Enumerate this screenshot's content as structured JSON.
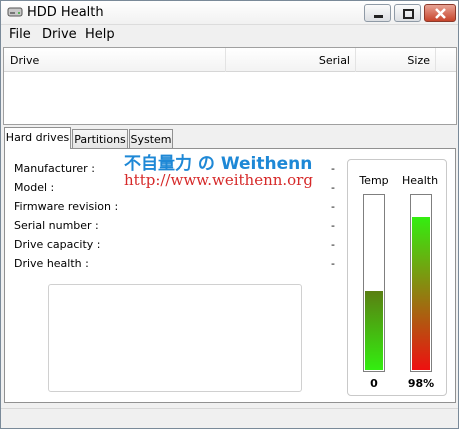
{
  "window": {
    "title": "HDD Health"
  },
  "menu": {
    "file": "File",
    "drive": "Drive",
    "help": "Help"
  },
  "drive_list": {
    "columns": [
      "Drive",
      "Serial",
      "Size"
    ],
    "rows": []
  },
  "tabs": [
    "Hard drives",
    "Partitions",
    "System"
  ],
  "details": {
    "labels": [
      "Manufacturer :",
      "Model :",
      "Firmware revision :",
      "Serial number :",
      "Drive capacity :",
      "Drive health :"
    ],
    "values": [
      "-",
      "-",
      "-",
      "-",
      "-",
      "-"
    ]
  },
  "watermark": {
    "line1": "不自量力 の Weithenn",
    "line2": "http://www.weithenn.org",
    "color1": "#1e88d6",
    "color2": "#d62a2a"
  },
  "gauges": {
    "temp": {
      "label": "Temp",
      "value_text": "0",
      "level": 0.45
    },
    "health": {
      "label": "Health",
      "value_text": "98%",
      "level": 0.87
    }
  },
  "colors": {
    "temp_fill_top": "#5a7f12",
    "temp_fill_bottom": "#33ee10",
    "health_fill_top": "#33ee10",
    "health_fill_bottom": "#ee1010"
  }
}
